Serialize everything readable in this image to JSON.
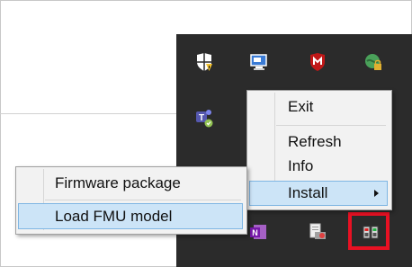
{
  "tray": {
    "icons": [
      {
        "name": "windows-security-warning-icon"
      },
      {
        "name": "remote-desktop-icon"
      },
      {
        "name": "mcafee-shield-icon"
      },
      {
        "name": "network-lock-icon"
      },
      {
        "name": "teams-icon"
      },
      {
        "name": "onenote-icon"
      },
      {
        "name": "printer-queue-icon"
      },
      {
        "name": "fmu-tool-icon"
      }
    ],
    "highlight_color": "#e81123"
  },
  "main_menu": {
    "items": [
      {
        "label": "Exit"
      },
      {
        "label": "Refresh"
      },
      {
        "label": "Info"
      },
      {
        "label": "Install"
      }
    ]
  },
  "submenu": {
    "items": [
      {
        "label": "Firmware package"
      },
      {
        "label": "Load FMU model"
      }
    ]
  },
  "colors": {
    "tray_bg": "#2b2b2b",
    "menu_bg": "#f2f2f2",
    "menu_highlight": "#cce4f7",
    "menu_highlight_border": "#7fb6e3"
  }
}
